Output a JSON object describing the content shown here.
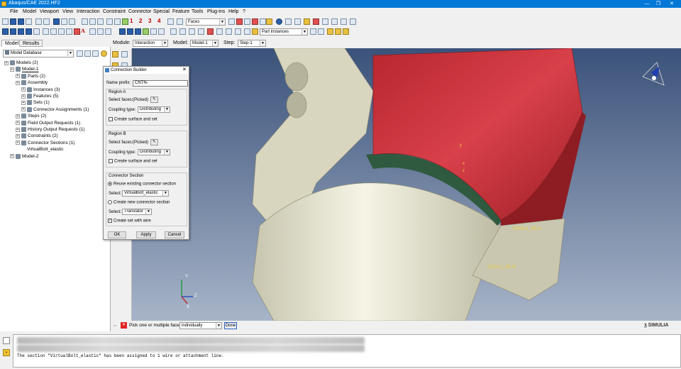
{
  "window": {
    "title": "Abaqus/CAE 2022.HF2",
    "controls": [
      "—",
      "❐",
      "✕"
    ]
  },
  "menu": [
    "File",
    "Model",
    "Viewport",
    "View",
    "Interaction",
    "Constraint",
    "Connector",
    "Special",
    "Feature",
    "Tools",
    "Plug-ins",
    "Help",
    "?"
  ],
  "toolbar": {
    "selection_filter": "Faces",
    "numbers": [
      "1",
      "2",
      "3",
      "4"
    ],
    "part_instances": "Part instances"
  },
  "context_bar": {
    "module_label": "Module:",
    "module_value": "Interaction",
    "model_label": "Model:",
    "model_value": "Model-1",
    "step_label": "Step:",
    "step_value": "Step-1"
  },
  "tabs": [
    "Model",
    "Results"
  ],
  "model_database_label": "Model Database",
  "tree": [
    {
      "label": "Models (2)",
      "indent": 0
    },
    {
      "label": "Model-1",
      "indent": 1
    },
    {
      "label": "Parts (2)",
      "indent": 2
    },
    {
      "label": "Assembly",
      "indent": 2
    },
    {
      "label": "Instances (3)",
      "indent": 3
    },
    {
      "label": "Features (5)",
      "indent": 3
    },
    {
      "label": "Sets (1)",
      "indent": 3
    },
    {
      "label": "Connector Assignments (1)",
      "indent": 3
    },
    {
      "label": "Steps (2)",
      "indent": 2
    },
    {
      "label": "Field Output Requests (1)",
      "indent": 2
    },
    {
      "label": "History Output Requests (1)",
      "indent": 2
    },
    {
      "label": "Constraints (2)",
      "indent": 2
    },
    {
      "label": "Connector Sections (1)",
      "indent": 2
    },
    {
      "label": "VirtualBolt_elastic",
      "indent": 3
    },
    {
      "label": "Model-2",
      "indent": 1
    }
  ],
  "dialog": {
    "title": "Connection Builder",
    "name_prefix_label": "Name prefix:",
    "name_prefix_value": "CNTN-",
    "region_a": "Region A",
    "region_b": "Region B",
    "select_faces_label": "Select faces:",
    "picked": "(Picked)",
    "coupling_type_label": "Coupling type:",
    "coupling_type_value": "Distributing",
    "create_surface": "Create surface and set",
    "connector_section": "Connector Section",
    "reuse": "Reuse existing connector section",
    "select_label": "Select:",
    "select_existing": "VirtualBolt_elastic",
    "create_new": "Create new connector section",
    "select_new": "Translator",
    "create_set": "Create set with wire",
    "ok": "OK",
    "apply": "Apply",
    "cancel": "Cancel"
  },
  "viewport": {
    "labels": [
      "CNTN-1_RP-A",
      "CNTN-1_RP-B"
    ],
    "axes": [
      "Y",
      "Z",
      "X"
    ],
    "triad_axes": [
      "y",
      "x",
      "z"
    ],
    "brand": "SIMULIA"
  },
  "prompt": {
    "text": "Pick one or multiple faces",
    "mode": "individually",
    "done": "Done"
  },
  "message": "The section \"VirtualBolt_elastic\" has been assigned to 1 wire or attachment line.",
  "colors": {
    "title_blue": "#0078d7",
    "part_red": "#c8303a",
    "part_cream": "#e8e6d2",
    "bg_top": "#3b527a",
    "bg_bottom": "#a7b4c8"
  }
}
